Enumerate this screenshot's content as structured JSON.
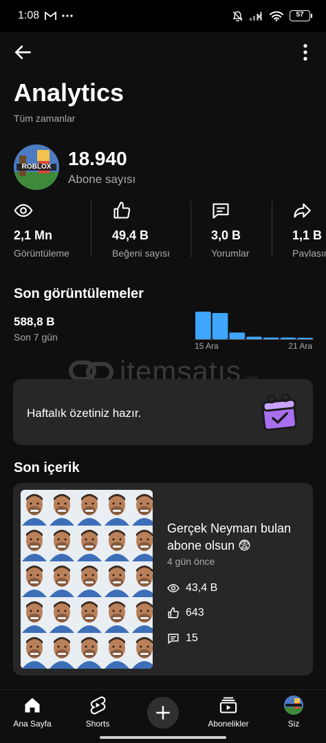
{
  "status_bar": {
    "time": "1:08",
    "left_icons": [
      "gmail-icon",
      "more-dots-icon"
    ],
    "right_icons": [
      "mute-bell-icon",
      "signal-icon",
      "wifi-icon",
      "battery-icon"
    ],
    "battery": "57"
  },
  "header": {
    "title": "Analytics",
    "subtitle": "Tüm zamanlar"
  },
  "channel": {
    "avatar_text": "ROBLOX",
    "subscriber_count": "18.940",
    "subscriber_label": "Abone sayısı"
  },
  "metrics": [
    {
      "icon": "eye-icon",
      "value": "2,1 Mn",
      "label": "Görüntüleme"
    },
    {
      "icon": "thumbs-up-icon",
      "value": "49,4 B",
      "label": "Beğeni sayısı"
    },
    {
      "icon": "comment-icon",
      "value": "3,0 B",
      "label": "Yorumlar"
    },
    {
      "icon": "share-icon",
      "value": "1,1 B",
      "label": "Paylaşım"
    }
  ],
  "recent_views": {
    "title": "Son görüntülemeler",
    "value": "588,8 B",
    "label": "Son 7 gün",
    "chart_data": {
      "type": "bar",
      "values": [
        1.0,
        0.95,
        0.24,
        0.09,
        0.06,
        0.06,
        0.05
      ],
      "x_start_label": "15 Ara",
      "x_end_label": "21 Ara",
      "color": "#3ea6ff"
    }
  },
  "watermark": {
    "text": "itemsatış",
    "small_text": ".com"
  },
  "weekly_summary": {
    "text": "Haftalık özetiniz hazır.",
    "icon": "calendar-check-icon",
    "icon_color": "#a86ff0"
  },
  "recent_content": {
    "title": "Son içerik",
    "video": {
      "title": "Gerçek Neymarı bulan abone olsun 😨",
      "age": "4 gün önce",
      "views": "43,4 B",
      "likes": "643",
      "comments": "15"
    }
  },
  "bottom_nav": {
    "items": [
      {
        "icon": "home-icon",
        "label": "Ana Sayfa"
      },
      {
        "icon": "shorts-icon",
        "label": "Shorts"
      },
      {
        "icon": "create-plus-icon",
        "label": ""
      },
      {
        "icon": "subscriptions-icon",
        "label": "Abonelikler"
      },
      {
        "icon": "profile-avatar-icon",
        "label": "Siz"
      }
    ]
  },
  "colors": {
    "background": "#0f0f0f",
    "card": "#272727",
    "secondary_text": "#aaaaaa",
    "accent_bar": "#3ea6ff"
  }
}
